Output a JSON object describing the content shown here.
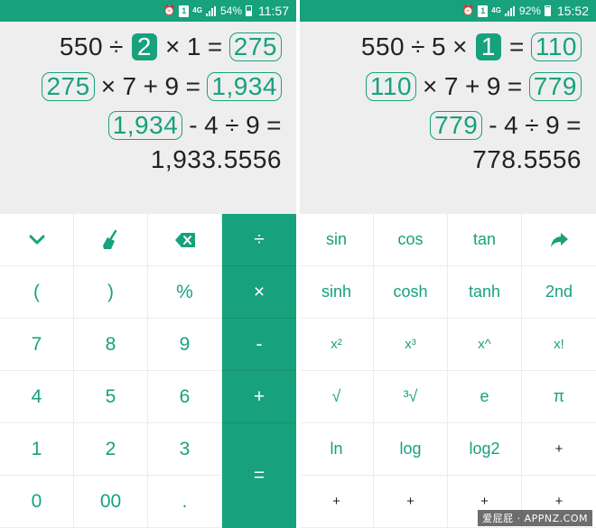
{
  "colors": {
    "accent": "#17a17d",
    "display_bg": "#eeeeee",
    "text": "#222222"
  },
  "left": {
    "status": {
      "battery": "54%",
      "time": "11:57",
      "sim": "1",
      "network": "4G"
    },
    "display": {
      "line1": {
        "a": "550",
        "op1": "÷",
        "b": "2",
        "op2": "×",
        "c": "1",
        "eq": "=",
        "result": "275"
      },
      "line2": {
        "a": "275",
        "op1": "×",
        "b": "7",
        "op2": "+",
        "c": "9",
        "eq": "=",
        "result": "1,934"
      },
      "line3": {
        "a": "1,934",
        "op1": "-",
        "b": "4",
        "op2": "÷",
        "c": "9",
        "eq": "="
      },
      "result": "1,933.5556"
    },
    "keys": {
      "row2": [
        "(",
        ")",
        "%"
      ],
      "row3": [
        "7",
        "8",
        "9"
      ],
      "row4": [
        "4",
        "5",
        "6"
      ],
      "row5": [
        "1",
        "2",
        "3"
      ],
      "row6": [
        "0",
        "00",
        "."
      ],
      "ops": [
        "÷",
        "×",
        "-",
        "+",
        "="
      ]
    },
    "icons": {
      "collapse": "chevron-down-icon",
      "clear": "broom-icon",
      "backspace": "backspace-icon"
    }
  },
  "right": {
    "status": {
      "battery": "92%",
      "time": "15:52",
      "sim": "1",
      "network": "4G"
    },
    "display": {
      "line1": {
        "a": "550",
        "op1": "÷",
        "b": "5",
        "op2": "×",
        "c": "1",
        "eq": "=",
        "result": "110"
      },
      "line2": {
        "a": "110",
        "op1": "×",
        "b": "7",
        "op2": "+",
        "c": "9",
        "eq": "=",
        "result": "779"
      },
      "line3": {
        "a": "779",
        "op1": "-",
        "b": "4",
        "op2": "÷",
        "c": "9",
        "eq": "="
      },
      "result": "778.5556"
    },
    "keys": {
      "row1": [
        "sin",
        "cos",
        "tan"
      ],
      "row2": [
        "sinh",
        "cosh",
        "tanh",
        "2nd"
      ],
      "row3": [
        "x²",
        "x³",
        "x^",
        "x!"
      ],
      "row4": [
        "√",
        "³√",
        "e",
        "π"
      ],
      "row5": [
        "ln",
        "log",
        "log2",
        "+"
      ],
      "row6": [
        "+",
        "+",
        "+",
        "+"
      ]
    },
    "icons": {
      "share": "share-arrow-icon"
    }
  },
  "watermark": "爱屁屁 · APPNZ.COM"
}
